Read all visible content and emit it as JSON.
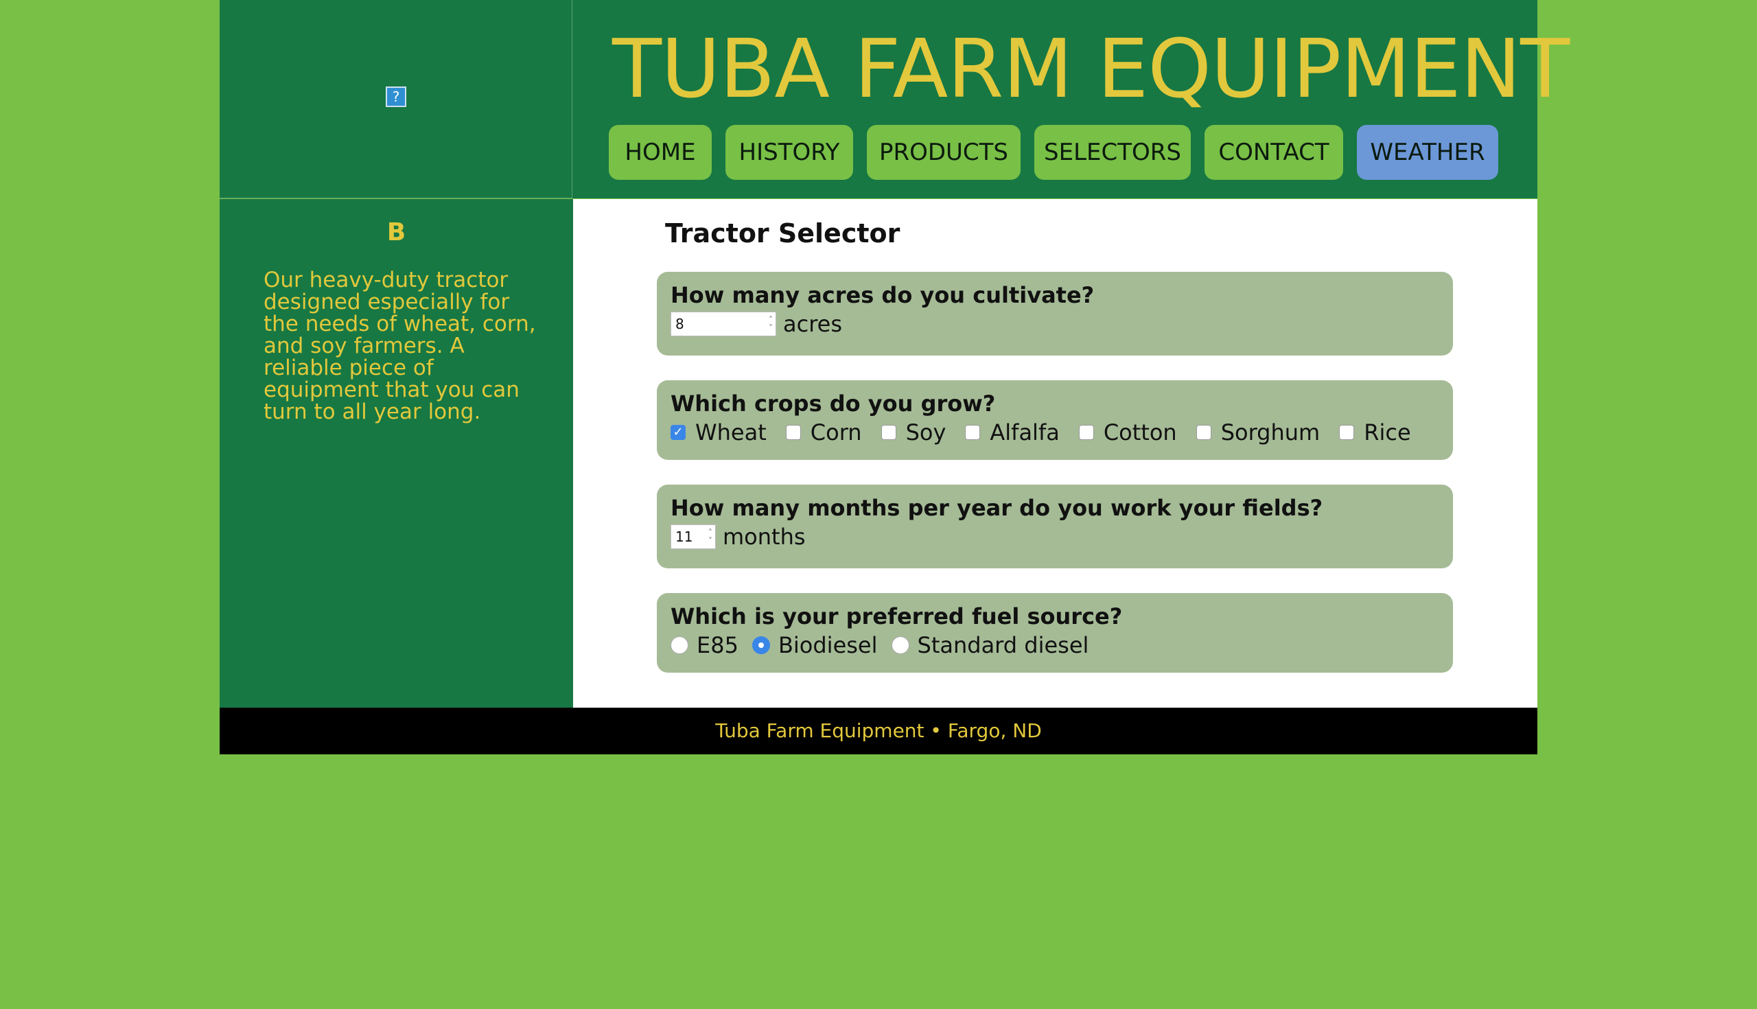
{
  "header": {
    "site_title": "TUBA FARM EQUIPMENT",
    "logo_alt": "?"
  },
  "nav": {
    "items": [
      {
        "label": "HOME"
      },
      {
        "label": "HISTORY"
      },
      {
        "label": "PRODUCTS"
      },
      {
        "label": "SELECTORS"
      },
      {
        "label": "CONTACT"
      },
      {
        "label": "WEATHER",
        "active": true
      }
    ]
  },
  "sidebar": {
    "title": "B",
    "text": "Our heavy-duty tractor designed especially for the needs of wheat, corn, and soy farmers. A reliable piece of equipment that you can turn to all year long."
  },
  "main": {
    "title": "Tractor Selector",
    "acres": {
      "question": "How many acres do you cultivate?",
      "value": "8",
      "unit": "acres"
    },
    "crops": {
      "question": "Which crops do you grow?",
      "options": [
        {
          "label": "Wheat",
          "checked": true
        },
        {
          "label": "Corn",
          "checked": false
        },
        {
          "label": "Soy",
          "checked": false
        },
        {
          "label": "Alfalfa",
          "checked": false
        },
        {
          "label": "Cotton",
          "checked": false
        },
        {
          "label": "Sorghum",
          "checked": false
        },
        {
          "label": "Rice",
          "checked": false
        }
      ]
    },
    "months": {
      "question": "How many months per year do you work your fields?",
      "value": "11",
      "unit": "months"
    },
    "fuel": {
      "question": "Which is your preferred fuel source?",
      "options": [
        {
          "label": "E85",
          "selected": false
        },
        {
          "label": "Biodiesel",
          "selected": true
        },
        {
          "label": "Standard diesel",
          "selected": false
        }
      ]
    }
  },
  "footer": {
    "text": "Tuba Farm Equipment • Fargo, ND"
  },
  "colors": {
    "background": "#78c046",
    "header_green": "#177843",
    "gold": "#e2c83c",
    "card": "#a5bb96",
    "active_nav": "#6c98d8"
  }
}
